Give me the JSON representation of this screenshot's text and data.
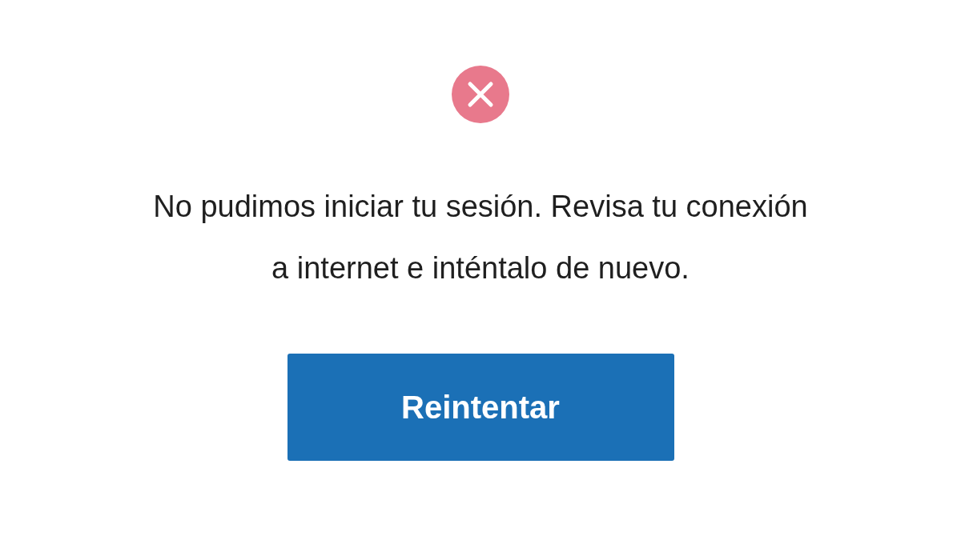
{
  "message": "No pudimos iniciar tu sesión. Revisa tu conexión a internet e inténtalo de nuevo.",
  "status": {
    "kind": "error"
  },
  "button": {
    "label": "Reintentar"
  }
}
